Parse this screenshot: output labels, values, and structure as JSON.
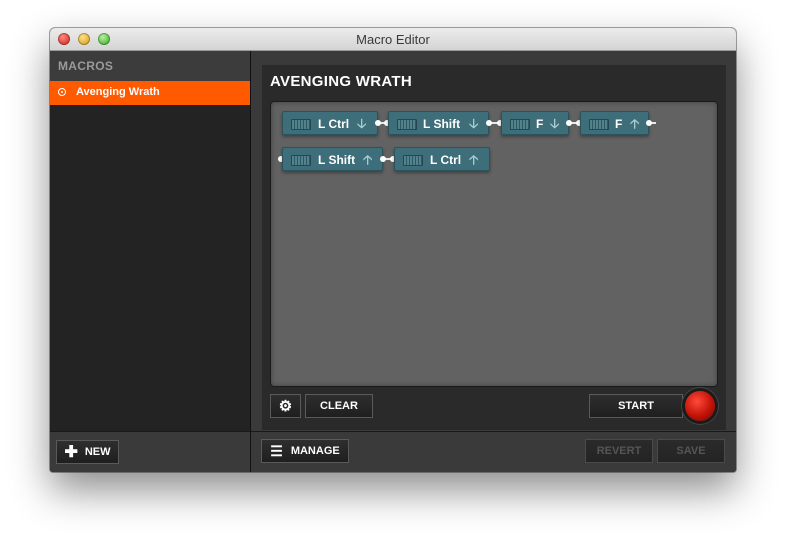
{
  "window": {
    "title": "Macro Editor"
  },
  "sidebar": {
    "header": "MACROS",
    "items": [
      {
        "label": "Avenging Wrath",
        "selected": true
      }
    ],
    "new_label": "NEW"
  },
  "editor": {
    "macro_name": "AVENGING WRATH",
    "steps": [
      {
        "key": "L Ctrl",
        "direction": "down",
        "arrow": "🡣"
      },
      {
        "key": "L Shift",
        "direction": "down",
        "arrow": "🡣"
      },
      {
        "key": "F",
        "direction": "down",
        "arrow": "🡣"
      },
      {
        "key": "F",
        "direction": "up",
        "arrow": "🡡"
      },
      {
        "key": "L Shift",
        "direction": "up",
        "arrow": "🡡"
      },
      {
        "key": "L Ctrl",
        "direction": "up",
        "arrow": "🡡"
      }
    ],
    "clear_label": "CLEAR",
    "start_label": "START"
  },
  "footer": {
    "manage_label": "MANAGE",
    "revert_label": "REVERT",
    "save_label": "SAVE"
  },
  "colors": {
    "accent": "#ff5a00",
    "step": "#3d6e79",
    "record": "#c21208"
  }
}
